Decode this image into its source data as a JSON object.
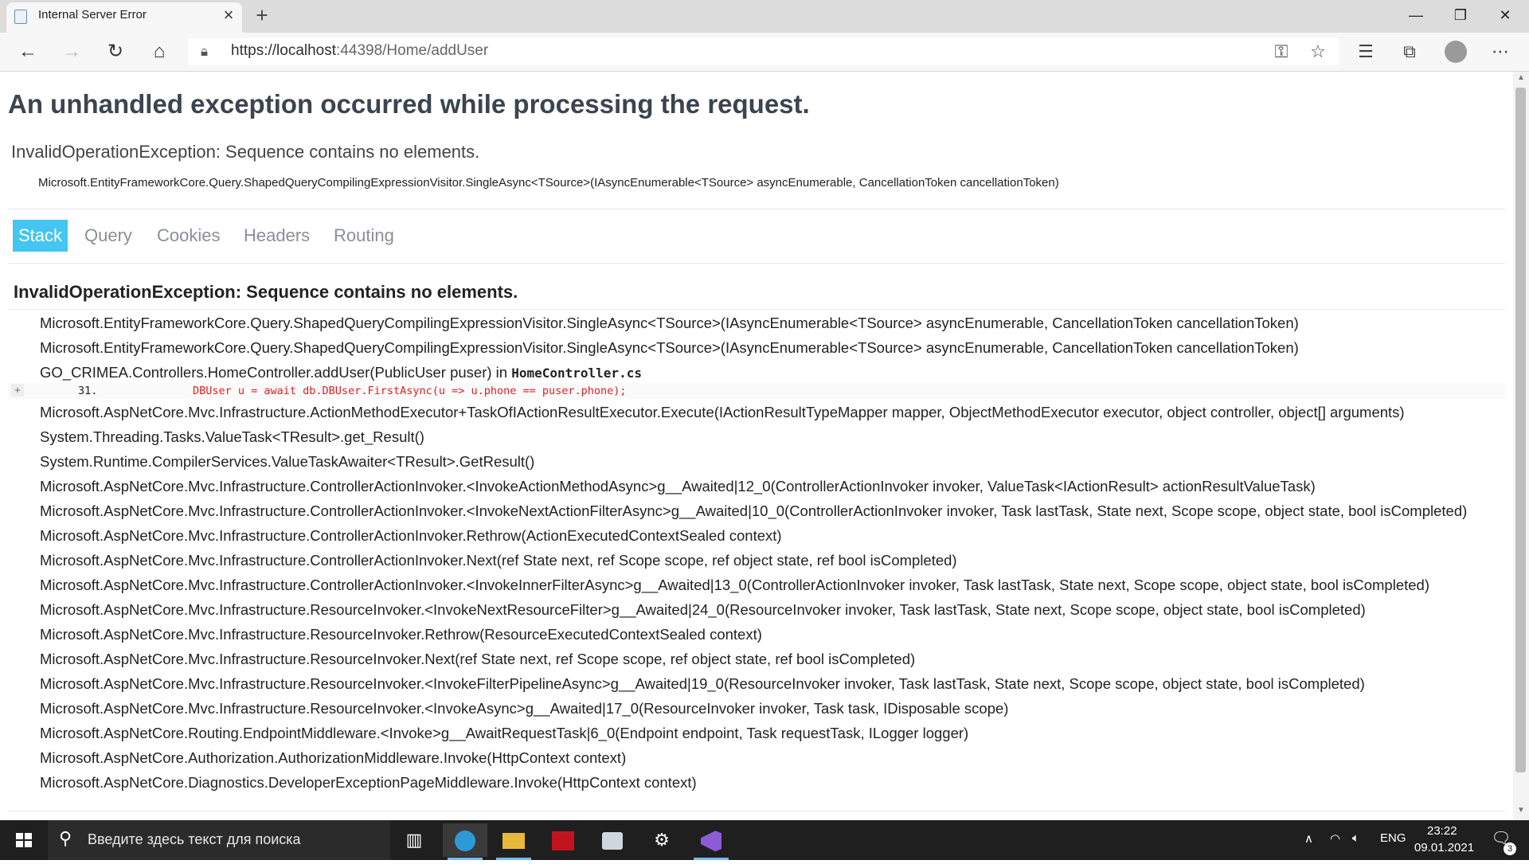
{
  "browser": {
    "tab_title": "Internal Server Error",
    "url_prefix": "https://",
    "url_host": "localhost",
    "url_rest": ":44398/Home/addUser"
  },
  "page": {
    "heading": "An unhandled exception occurred while processing the request.",
    "exception_title": "InvalidOperationException: Sequence contains no elements.",
    "exception_location": "Microsoft.EntityFrameworkCore.Query.ShapedQueryCompilingExpressionVisitor.SingleAsync<TSource>(IAsyncEnumerable<TSource> asyncEnumerable, CancellationToken cancellationToken)",
    "tabs": [
      "Stack",
      "Query",
      "Cookies",
      "Headers",
      "Routing"
    ],
    "stack_heading": "InvalidOperationException: Sequence contains no elements.",
    "frames_top": [
      "Microsoft.EntityFrameworkCore.Query.ShapedQueryCompilingExpressionVisitor.SingleAsync<TSource>(IAsyncEnumerable<TSource> asyncEnumerable, CancellationToken cancellationToken)",
      "Microsoft.EntityFrameworkCore.Query.ShapedQueryCompilingExpressionVisitor.SingleAsync<TSource>(IAsyncEnumerable<TSource> asyncEnumerable, CancellationToken cancellationToken)"
    ],
    "frame_user": "GO_CRIMEA.Controllers.HomeController.addUser(PublicUser puser) in ",
    "frame_user_file": "HomeController.cs",
    "expand_symbol": "+",
    "code_line_number": "31.",
    "code_line_text": "DBUser u = await db.DBUser.FirstAsync(u => u.phone == puser.phone);",
    "frames_rest": [
      "Microsoft.AspNetCore.Mvc.Infrastructure.ActionMethodExecutor+TaskOfIActionResultExecutor.Execute(IActionResultTypeMapper mapper, ObjectMethodExecutor executor, object controller, object[] arguments)",
      "System.Threading.Tasks.ValueTask<TResult>.get_Result()",
      "System.Runtime.CompilerServices.ValueTaskAwaiter<TResult>.GetResult()",
      "Microsoft.AspNetCore.Mvc.Infrastructure.ControllerActionInvoker.<InvokeActionMethodAsync>g__Awaited|12_0(ControllerActionInvoker invoker, ValueTask<IActionResult> actionResultValueTask)",
      "Microsoft.AspNetCore.Mvc.Infrastructure.ControllerActionInvoker.<InvokeNextActionFilterAsync>g__Awaited|10_0(ControllerActionInvoker invoker, Task lastTask, State next, Scope scope, object state, bool isCompleted)",
      "Microsoft.AspNetCore.Mvc.Infrastructure.ControllerActionInvoker.Rethrow(ActionExecutedContextSealed context)",
      "Microsoft.AspNetCore.Mvc.Infrastructure.ControllerActionInvoker.Next(ref State next, ref Scope scope, ref object state, ref bool isCompleted)",
      "Microsoft.AspNetCore.Mvc.Infrastructure.ControllerActionInvoker.<InvokeInnerFilterAsync>g__Awaited|13_0(ControllerActionInvoker invoker, Task lastTask, State next, Scope scope, object state, bool isCompleted)",
      "Microsoft.AspNetCore.Mvc.Infrastructure.ResourceInvoker.<InvokeNextResourceFilter>g__Awaited|24_0(ResourceInvoker invoker, Task lastTask, State next, Scope scope, object state, bool isCompleted)",
      "Microsoft.AspNetCore.Mvc.Infrastructure.ResourceInvoker.Rethrow(ResourceExecutedContextSealed context)",
      "Microsoft.AspNetCore.Mvc.Infrastructure.ResourceInvoker.Next(ref State next, ref Scope scope, ref object state, ref bool isCompleted)",
      "Microsoft.AspNetCore.Mvc.Infrastructure.ResourceInvoker.<InvokeFilterPipelineAsync>g__Awaited|19_0(ResourceInvoker invoker, Task lastTask, State next, Scope scope, object state, bool isCompleted)",
      "Microsoft.AspNetCore.Mvc.Infrastructure.ResourceInvoker.<InvokeAsync>g__Awaited|17_0(ResourceInvoker invoker, Task task, IDisposable scope)",
      "Microsoft.AspNetCore.Routing.EndpointMiddleware.<Invoke>g__AwaitRequestTask|6_0(Endpoint endpoint, Task requestTask, ILogger logger)",
      "Microsoft.AspNetCore.Authorization.AuthorizationMiddleware.Invoke(HttpContext context)",
      "Microsoft.AspNetCore.Diagnostics.DeveloperExceptionPageMiddleware.Invoke(HttpContext context)"
    ]
  },
  "taskbar": {
    "search_placeholder": "Введите здесь текст для поиска",
    "language": "ENG",
    "time": "23:22",
    "date": "09.01.2021",
    "notification_count": "3"
  },
  "colors": {
    "active_tab": "#44c5f2",
    "code_highlight": "#dd2222",
    "taskbar": "#1f1f1f"
  },
  "icons": [
    "back-icon",
    "forward-icon",
    "refresh-icon",
    "home-icon",
    "lock-icon",
    "key-icon",
    "star-icon",
    "favorites-icon",
    "collections-icon",
    "profile-icon",
    "more-icon",
    "windows-start-icon",
    "search-icon",
    "task-view-icon",
    "edge-icon",
    "explorer-icon",
    "app-icon",
    "app2-icon",
    "settings-icon",
    "visual-studio-icon",
    "chevron-up-icon",
    "network-icon",
    "volume-icon",
    "notification-icon"
  ]
}
